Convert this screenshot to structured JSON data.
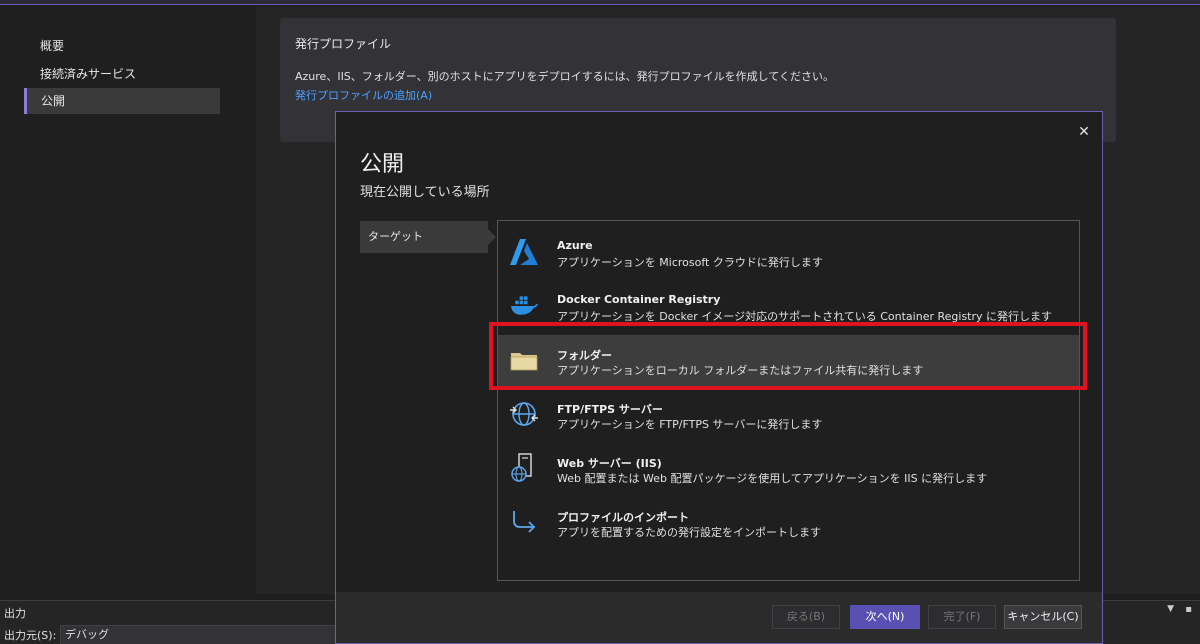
{
  "nav": {
    "items": [
      {
        "label": "概要"
      },
      {
        "label": "接続済みサービス"
      },
      {
        "label": "公開"
      }
    ]
  },
  "profile": {
    "title": "発行プロファイル",
    "description": "Azure、IIS、フォルダー、別のホストにアプリをデプロイするには、発行プロファイルを作成してください。",
    "add_link": "発行プロファイルの追加(A)"
  },
  "dialog": {
    "title": "公開",
    "subtitle": "現在公開している場所",
    "step": "ターゲット",
    "targets": [
      {
        "name": "Azure",
        "desc": "アプリケーションを Microsoft クラウドに発行します",
        "icon": "azure-icon"
      },
      {
        "name": "Docker Container Registry",
        "desc": "アプリケーションを Docker イメージ対応のサポートされている Container Registry に発行します",
        "icon": "docker-icon"
      },
      {
        "name": "フォルダー",
        "desc": "アプリケーションをローカル フォルダーまたはファイル共有に発行します",
        "icon": "folder-icon"
      },
      {
        "name": "FTP/FTPS サーバー",
        "desc": "アプリケーションを FTP/FTPS サーバーに発行します",
        "icon": "ftp-globe-icon"
      },
      {
        "name": "Web サーバー (IIS)",
        "desc": "Web 配置または Web 配置パッケージを使用してアプリケーションを IIS に発行します",
        "icon": "web-server-icon"
      },
      {
        "name": "プロファイルのインポート",
        "desc": "アプリを配置するための発行設定をインポートします",
        "icon": "import-arrow-icon"
      }
    ],
    "buttons": {
      "back": "戻る(B)",
      "next": "次へ(N)",
      "finish": "完了(F)",
      "cancel": "キャンセル(C)"
    }
  },
  "output": {
    "title": "出力",
    "source_label": "出力元(S):",
    "source_value": "デバッグ"
  },
  "colors": {
    "accent": "#5a4fb3",
    "highlight": "#e0141e",
    "link": "#4ea1ff"
  }
}
